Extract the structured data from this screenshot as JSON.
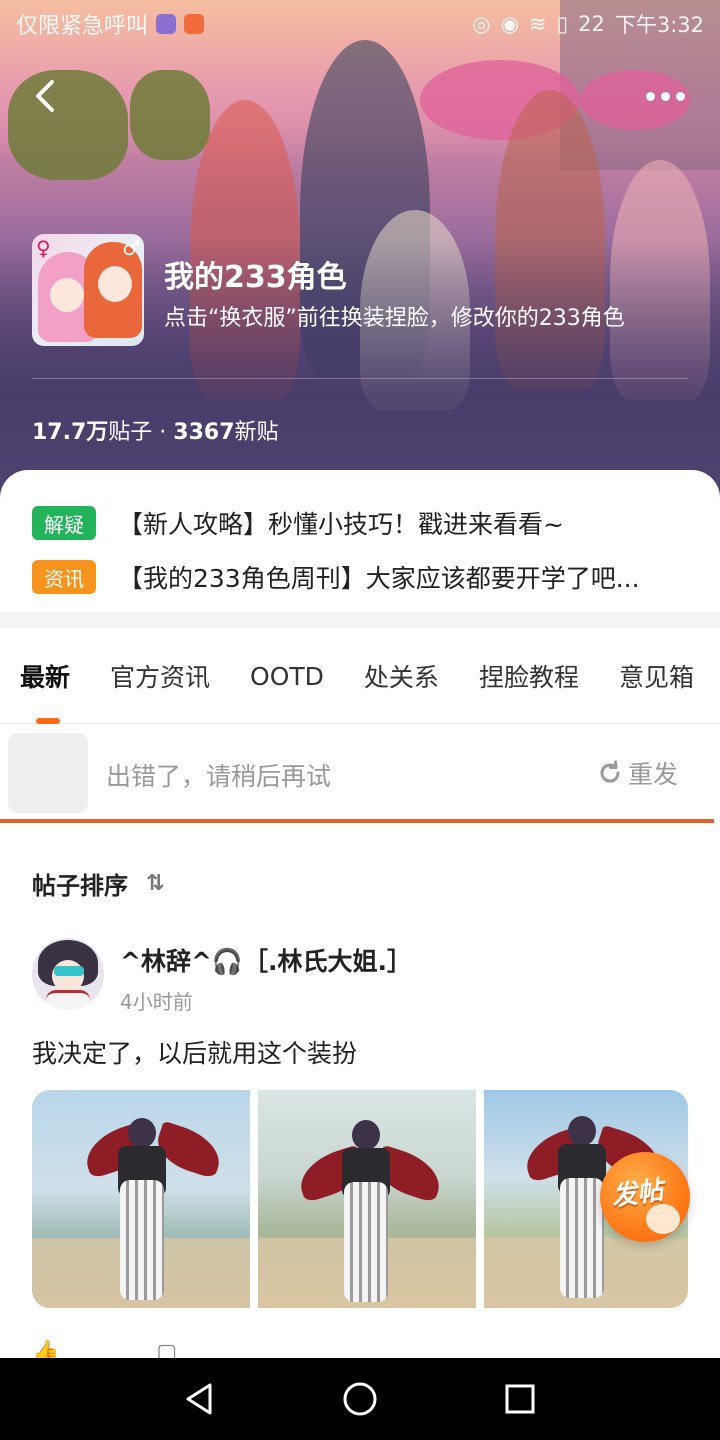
{
  "status_bar": {
    "left_text": "仅限紧急呼叫",
    "battery": "22",
    "time": "下午3:32"
  },
  "header": {
    "forum_title": "我的233角色",
    "forum_subtitle": "点击“换衣服”前往换装捏脸，修改你的233角色",
    "stats": {
      "posts_count": "17.7万",
      "posts_label": "贴子",
      "separator": " · ",
      "new_count": "3367",
      "new_label": "新贴"
    }
  },
  "pinned": [
    {
      "tag": "解疑",
      "tag_color": "#22b35b",
      "text": "【新人攻略】秒懂小技巧！戳进来看看~"
    },
    {
      "tag": "资讯",
      "tag_color": "#f7941d",
      "text": "【我的233角色周刊】大家应该都要开学了吧..."
    }
  ],
  "tabs": [
    "最新",
    "官方资讯",
    "OOTD",
    "处关系",
    "捏脸教程",
    "意见箱"
  ],
  "active_tab": 0,
  "error_bar": {
    "message": "出错了，请稍后再试",
    "retry_label": "重发"
  },
  "feed": {
    "sort_label": "帖子排序",
    "post": {
      "author": "^林辞^🎧［.林氏大姐.］",
      "time": "4小时前",
      "text": "我决定了，以后就用这个装扮"
    }
  },
  "fab": {
    "label": "发帖"
  },
  "colors": {
    "accent": "#ff6a1a",
    "error_line": "#e8612b",
    "tag_green": "#22b35b",
    "tag_orange": "#f7941d"
  }
}
